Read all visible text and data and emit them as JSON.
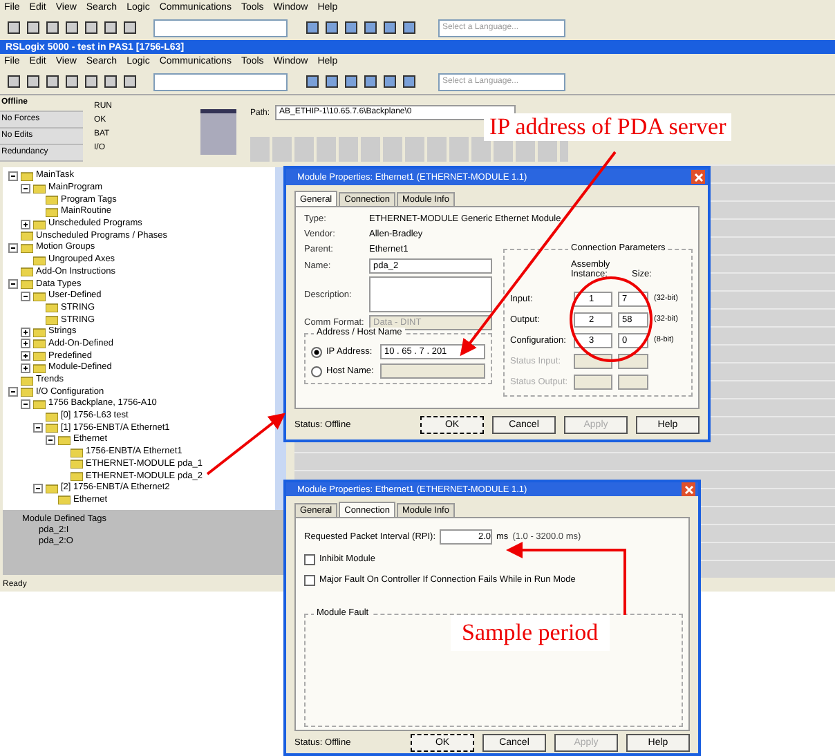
{
  "back_window": {
    "menu": [
      "File",
      "Edit",
      "View",
      "Search",
      "Logic",
      "Communications",
      "Tools",
      "Window",
      "Help"
    ],
    "language_placeholder": "Select a Language..."
  },
  "window": {
    "title": "RSLogix 5000 - test in PAS1 [1756-L63]",
    "menu": [
      "File",
      "Edit",
      "View",
      "Search",
      "Logic",
      "Communications",
      "Tools",
      "Window",
      "Help"
    ],
    "language_placeholder": "Select a Language..."
  },
  "controller_status": [
    {
      "label": "Offline"
    },
    {
      "label": "No Forces"
    },
    {
      "label": "No Edits"
    },
    {
      "label": "Redundancy"
    }
  ],
  "leds": [
    "RUN",
    "OK",
    "BAT",
    "I/O"
  ],
  "path": {
    "label": "Path:",
    "value": "AB_ETHIP-1\\10.65.7.6\\Backplane\\0"
  },
  "tree": [
    {
      "label": "MainTask",
      "expanded": true,
      "children": [
        {
          "label": "MainProgram",
          "expanded": true,
          "children": [
            {
              "label": "Program Tags"
            },
            {
              "label": "MainRoutine"
            }
          ]
        },
        {
          "label": "Unscheduled Programs",
          "expanded": false
        }
      ]
    },
    {
      "label": "Unscheduled Programs / Phases"
    },
    {
      "label": "Motion Groups",
      "expanded": true,
      "children": [
        {
          "label": "Ungrouped Axes"
        }
      ]
    },
    {
      "label": "Add-On Instructions"
    },
    {
      "label": "Data Types",
      "expanded": true,
      "children": [
        {
          "label": "User-Defined",
          "expanded": true,
          "children": [
            {
              "label": "STRING"
            },
            {
              "label": "STRING"
            }
          ]
        },
        {
          "label": "Strings",
          "expanded": false
        },
        {
          "label": "Add-On-Defined",
          "expanded": false
        },
        {
          "label": "Predefined",
          "expanded": false
        },
        {
          "label": "Module-Defined",
          "expanded": false
        }
      ]
    },
    {
      "label": "Trends"
    },
    {
      "label": "I/O Configuration",
      "expanded": true,
      "children": [
        {
          "label": "1756 Backplane, 1756-A10",
          "expanded": true,
          "children": [
            {
              "label": "[0] 1756-L63 test"
            },
            {
              "label": "[1] 1756-ENBT/A Ethernet1",
              "expanded": true,
              "children": [
                {
                  "label": "Ethernet",
                  "expanded": true,
                  "children": [
                    {
                      "label": "1756-ENBT/A Ethernet1"
                    },
                    {
                      "label": "ETHERNET-MODULE pda_1"
                    },
                    {
                      "label": "ETHERNET-MODULE pda_2"
                    }
                  ]
                }
              ]
            },
            {
              "label": "[2] 1756-ENBT/A Ethernet2",
              "expanded": true,
              "children": [
                {
                  "label": "Ethernet"
                }
              ]
            }
          ]
        }
      ]
    }
  ],
  "tags_pane": {
    "title": "Module Defined Tags",
    "items": [
      "pda_2:I",
      "pda_2:O"
    ]
  },
  "status_bar": "Ready",
  "dialogs": [
    {
      "kind": "general",
      "title": "Module Properties: Ethernet1 (ETHERNET-MODULE 1.1)",
      "tabs": [
        {
          "label": "General",
          "selected": true
        },
        {
          "label": "Connection",
          "selected": false
        },
        {
          "label": "Module Info",
          "selected": false
        }
      ],
      "type_label": "Type:",
      "type": "ETHERNET-MODULE Generic Ethernet Module",
      "vendor_label": "Vendor:",
      "vendor": "Allen-Bradley",
      "parent_label": "Parent:",
      "parent": "Ethernet1",
      "name_label": "Name:",
      "name": "pda_2",
      "description_label": "Description:",
      "comm_format_label": "Comm Format:",
      "comm_format": "Data - DINT",
      "address_group": "Address / Host Name",
      "address_options": [
        {
          "label": "IP Address:",
          "selected": true,
          "value": "10 . 65 . 7 . 201"
        },
        {
          "label": "Host Name:",
          "selected": false
        }
      ],
      "params_title": "Connection Parameters",
      "col_instance": "Assembly Instance:",
      "col_size": "Size:",
      "params": [
        {
          "label": "Input:",
          "instance": "1",
          "size": "7",
          "unit": "(32-bit)",
          "disabled": false
        },
        {
          "label": "Output:",
          "instance": "2",
          "size": "58",
          "unit": "(32-bit)",
          "disabled": false
        },
        {
          "label": "Configuration:",
          "instance": "3",
          "size": "0",
          "unit": "(8-bit)",
          "disabled": false
        },
        {
          "label": "Status Input:",
          "disabled": true
        },
        {
          "label": "Status Output:",
          "disabled": true
        }
      ],
      "status": "Status:  Offline",
      "buttons": [
        {
          "label": "OK",
          "disabled": false
        },
        {
          "label": "Cancel",
          "disabled": false
        },
        {
          "label": "Apply",
          "disabled": true
        },
        {
          "label": "Help",
          "disabled": false
        }
      ]
    },
    {
      "kind": "connection",
      "title": "Module Properties: Ethernet1 (ETHERNET-MODULE 1.1)",
      "tabs": [
        {
          "label": "General",
          "selected": false
        },
        {
          "label": "Connection",
          "selected": true
        },
        {
          "label": "Module Info",
          "selected": false
        }
      ],
      "rpi_label": "Requested Packet Interval (RPI):",
      "rpi": "2.0",
      "rpi_unit": "ms",
      "rpi_range": "(1.0 - 3200.0 ms)",
      "checks": [
        {
          "label": "Inhibit Module",
          "checked": false
        },
        {
          "label": "Major Fault On Controller If Connection Fails While in Run Mode",
          "checked": false
        }
      ],
      "fault_group": "Module Fault",
      "status": "Status:  Offline",
      "buttons": [
        {
          "label": "OK",
          "disabled": false
        },
        {
          "label": "Cancel",
          "disabled": false
        },
        {
          "label": "Apply",
          "disabled": true
        },
        {
          "label": "Help",
          "disabled": false
        }
      ]
    }
  ],
  "callouts": [
    "IP address of PDA server",
    "Sample period"
  ]
}
